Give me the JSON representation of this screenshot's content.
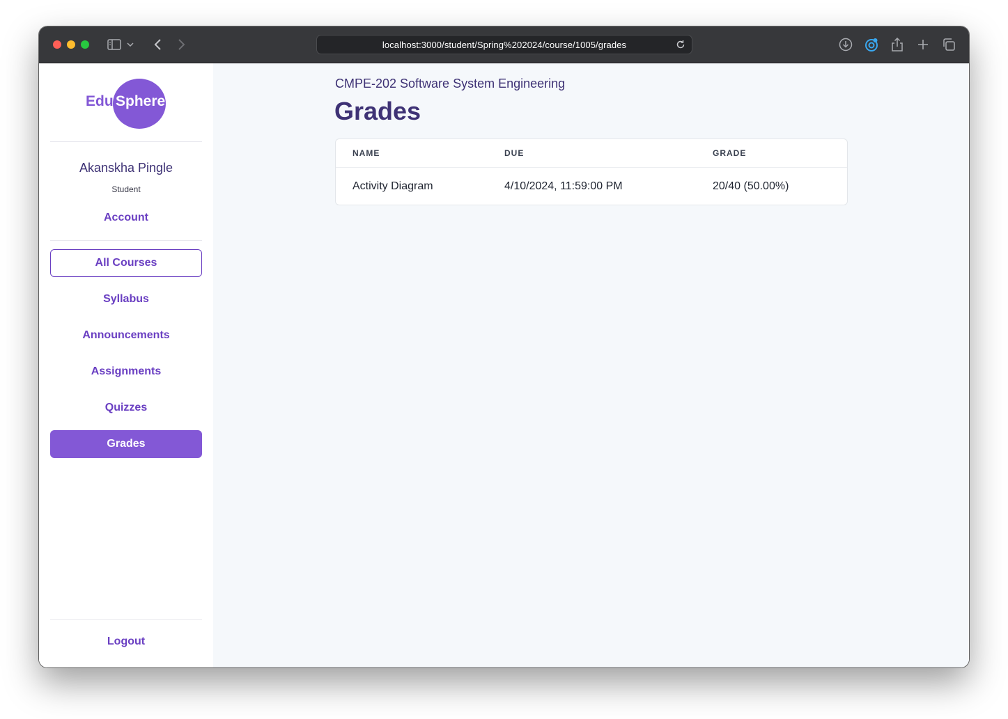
{
  "browser": {
    "url": "localhost:3000/student/Spring%202024/course/1005/grades"
  },
  "logo": {
    "part1": "Edu",
    "part2": "Sphere"
  },
  "user": {
    "name": "Akanskha Pingle",
    "role": "Student"
  },
  "sidebar": {
    "account": "Account",
    "items": [
      {
        "label": "All Courses"
      },
      {
        "label": "Syllabus"
      },
      {
        "label": "Announcements"
      },
      {
        "label": "Assignments"
      },
      {
        "label": "Quizzes"
      },
      {
        "label": "Grades"
      }
    ],
    "logout": "Logout"
  },
  "main": {
    "course_title": "CMPE-202 Software System Engineering",
    "page_title": "Grades",
    "table": {
      "columns": [
        "NAME",
        "DUE",
        "GRADE"
      ],
      "rows": [
        [
          "Activity Diagram",
          "4/10/2024, 11:59:00 PM",
          "20/40 (50.00%)"
        ]
      ]
    }
  },
  "colors": {
    "accent": "#8358d6",
    "accent_text": "#6a3fc2",
    "heading": "#3e3275",
    "background": "#f5f8fb"
  }
}
